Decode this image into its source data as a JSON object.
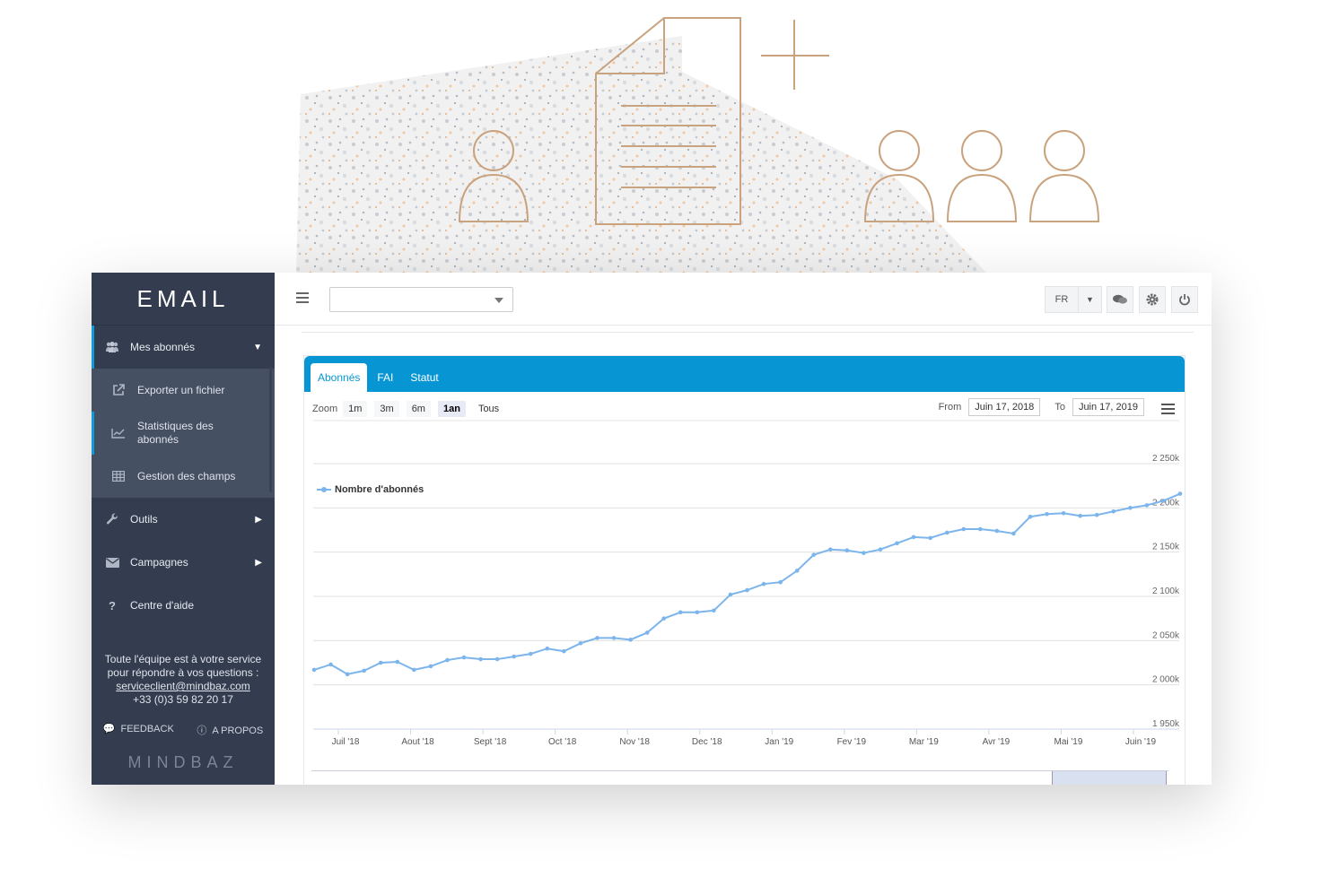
{
  "sidebar": {
    "brand": "EMAIL",
    "menu_main": "Mes abonnés",
    "sub_items": [
      {
        "label": "Exporter un fichier",
        "icon": "external-link-icon"
      },
      {
        "label": "Statistiques des abonnés",
        "icon": "line-chart-icon"
      },
      {
        "label": "Gestion des champs",
        "icon": "table-icon"
      }
    ],
    "items": [
      {
        "label": "Outils",
        "icon": "wrench-icon"
      },
      {
        "label": "Campagnes",
        "icon": "envelope-icon"
      },
      {
        "label": "Centre d'aide",
        "icon": "question-icon"
      }
    ],
    "footer": {
      "line1": "Toute l'équipe est à votre service",
      "line2": "pour répondre à vos questions :",
      "email": "serviceclient@mindbaz.com",
      "phone": "+33 (0)3 59 82 20 17",
      "feedback": "FEEDBACK",
      "about": "A PROPOS",
      "logo": "MINDBAZ"
    }
  },
  "topbar": {
    "lang": "FR",
    "select_value": ""
  },
  "tabs": [
    "Abonnés",
    "FAI",
    "Statut"
  ],
  "zoom": {
    "label": "Zoom",
    "options": [
      "1m",
      "3m",
      "6m",
      "1an",
      "Tous"
    ],
    "selected": "1an"
  },
  "range": {
    "from_label": "From",
    "from": "Juin 17, 2018",
    "to_label": "To",
    "to": "Juin 17, 2019"
  },
  "chart_data": {
    "type": "line",
    "series": [
      {
        "name": "Nombre d'abonnés",
        "color": "#7cb5ec",
        "values": [
          2017,
          2023,
          2012,
          2016,
          2025,
          2026,
          2017,
          2021,
          2028,
          2031,
          2029,
          2029,
          2032,
          2035,
          2041,
          2038,
          2047,
          2053,
          2053,
          2051,
          2059,
          2075,
          2082,
          2082,
          2084,
          2102,
          2107,
          2114,
          2116,
          2129,
          2147,
          2153,
          2152,
          2149,
          2153,
          2160,
          2167,
          2166,
          2172,
          2176,
          2176,
          2174,
          2171,
          2190,
          2193,
          2194,
          2191,
          2192,
          2196,
          2200,
          2203,
          2208,
          2216
        ]
      }
    ],
    "x_range": [
      "2018-06-17",
      "2019-06-17"
    ],
    "x_tick_labels": [
      "Juil '18",
      "Aout '18",
      "Sept '18",
      "Oct '18",
      "Nov '18",
      "Dec '18",
      "Jan '19",
      "Fev '19",
      "Mar '19",
      "Avr '19",
      "Mai '19",
      "Juin '19"
    ],
    "y_tick_labels": [
      "1 950k",
      "2 000k",
      "2 050k",
      "2 100k",
      "2 150k",
      "2 200k",
      "2 250k"
    ],
    "ylim": [
      1950,
      2250
    ],
    "y_unit": "k",
    "grid": true,
    "legend": "top-left"
  }
}
